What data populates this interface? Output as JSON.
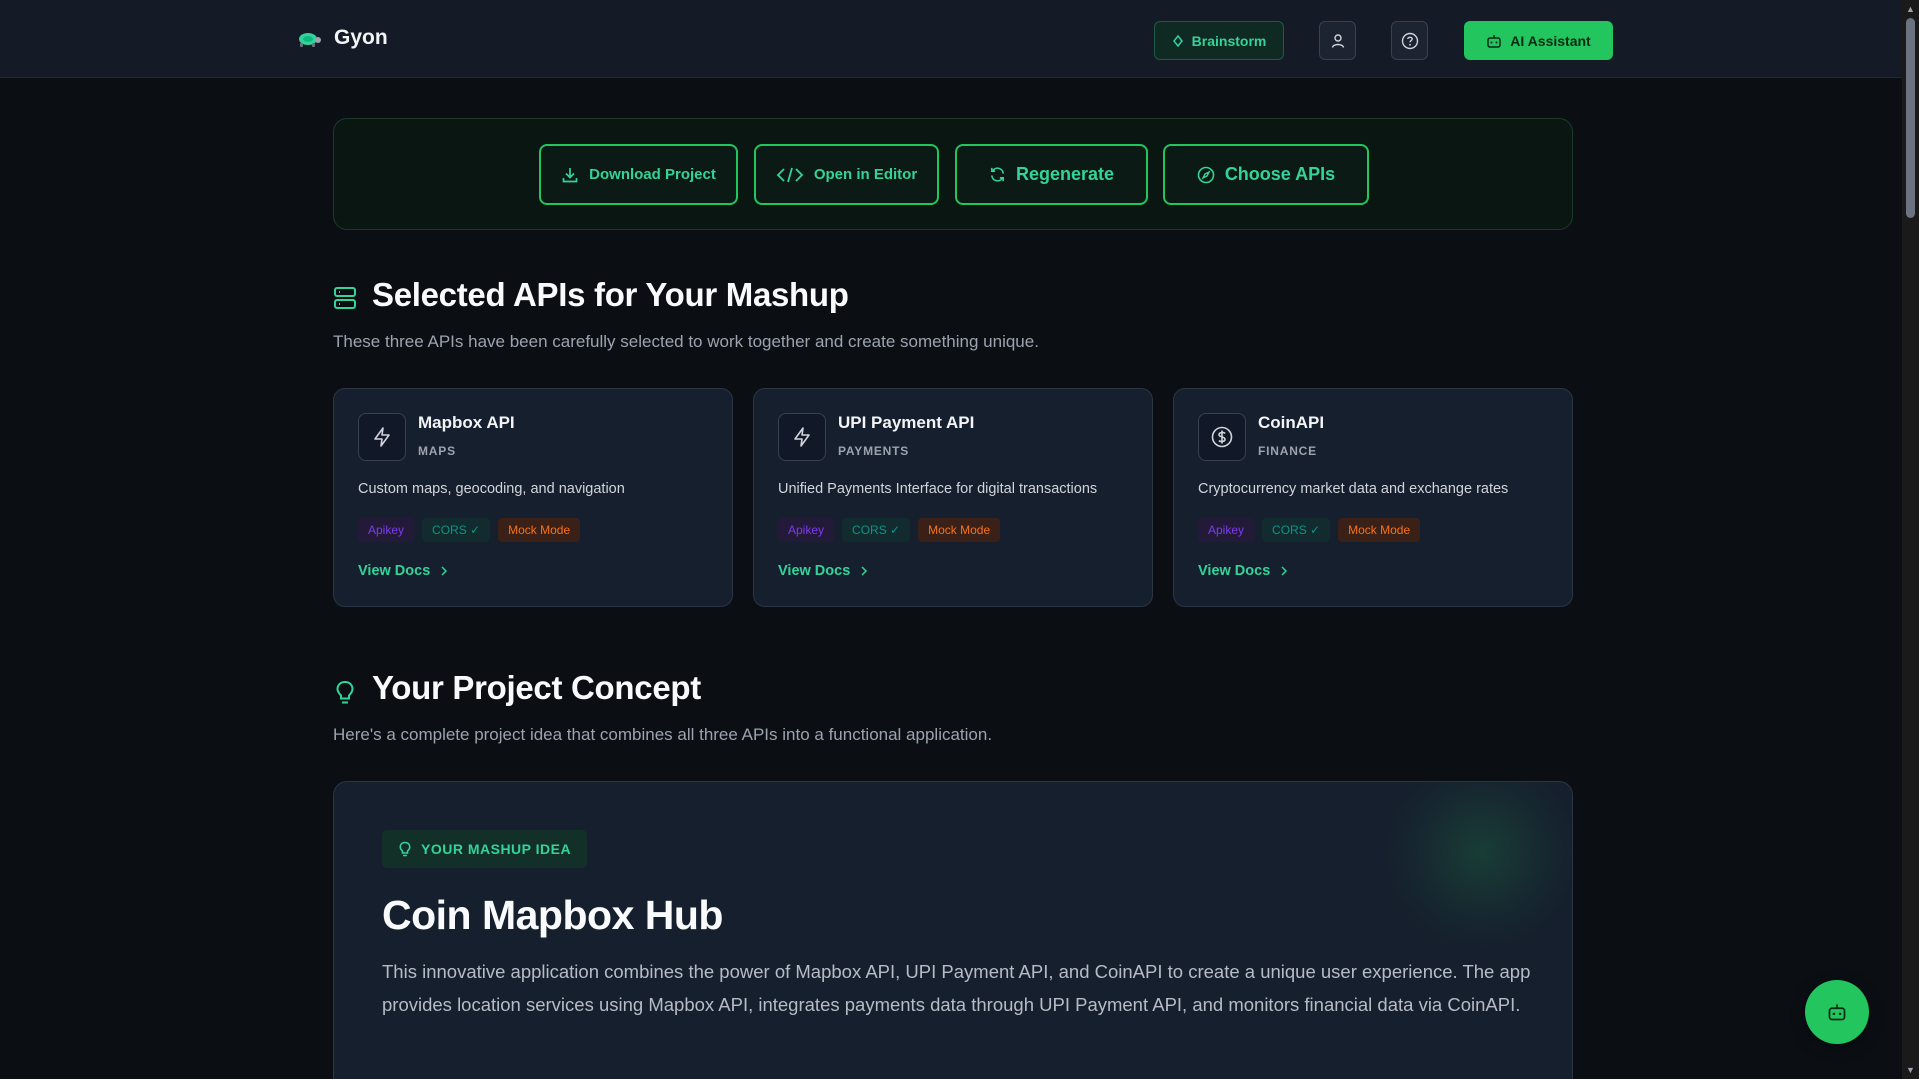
{
  "header": {
    "brand": "Gyon",
    "brainstorm_label": "Brainstorm",
    "ai_assistant_label": "AI Assistant"
  },
  "actions": {
    "download": "Download Project",
    "editor": "Open in Editor",
    "regenerate": "Regenerate",
    "choose": "Choose APIs"
  },
  "selected_section": {
    "title": "Selected APIs for Your Mashup",
    "subtitle": "These three APIs have been carefully selected to work together and create something unique."
  },
  "apis": [
    {
      "name": "Mapbox API",
      "category": "MAPS",
      "description": "Custom maps, geocoding, and navigation",
      "auth": "Apikey",
      "cors": "CORS ✓",
      "mock": "Mock Mode",
      "docs": "View Docs",
      "icon": "lightning-icon"
    },
    {
      "name": "UPI Payment API",
      "category": "PAYMENTS",
      "description": "Unified Payments Interface for digital transactions",
      "auth": "Apikey",
      "cors": "CORS ✓",
      "mock": "Mock Mode",
      "docs": "View Docs",
      "icon": "lightning-icon"
    },
    {
      "name": "CoinAPI",
      "category": "FINANCE",
      "description": "Cryptocurrency market data and exchange rates",
      "auth": "Apikey",
      "cors": "CORS ✓",
      "mock": "Mock Mode",
      "docs": "View Docs",
      "icon": "dollar-coin-icon"
    }
  ],
  "concept_section": {
    "title": "Your Project Concept",
    "subtitle": "Here's a complete project idea that combines all three APIs into a functional application."
  },
  "concept": {
    "badge": "YOUR MASHUP IDEA",
    "title": "Coin Mapbox Hub",
    "description": "This innovative application combines the power of Mapbox API, UPI Payment API, and CoinAPI to create a unique user experience. The app provides location services using Mapbox API, integrates payments data through UPI Payment API, and monitors financial data via CoinAPI."
  },
  "colors": {
    "accent": "#22c55e",
    "accent_text": "#34d399",
    "background": "#0b0f14",
    "card": "#161f2d"
  }
}
